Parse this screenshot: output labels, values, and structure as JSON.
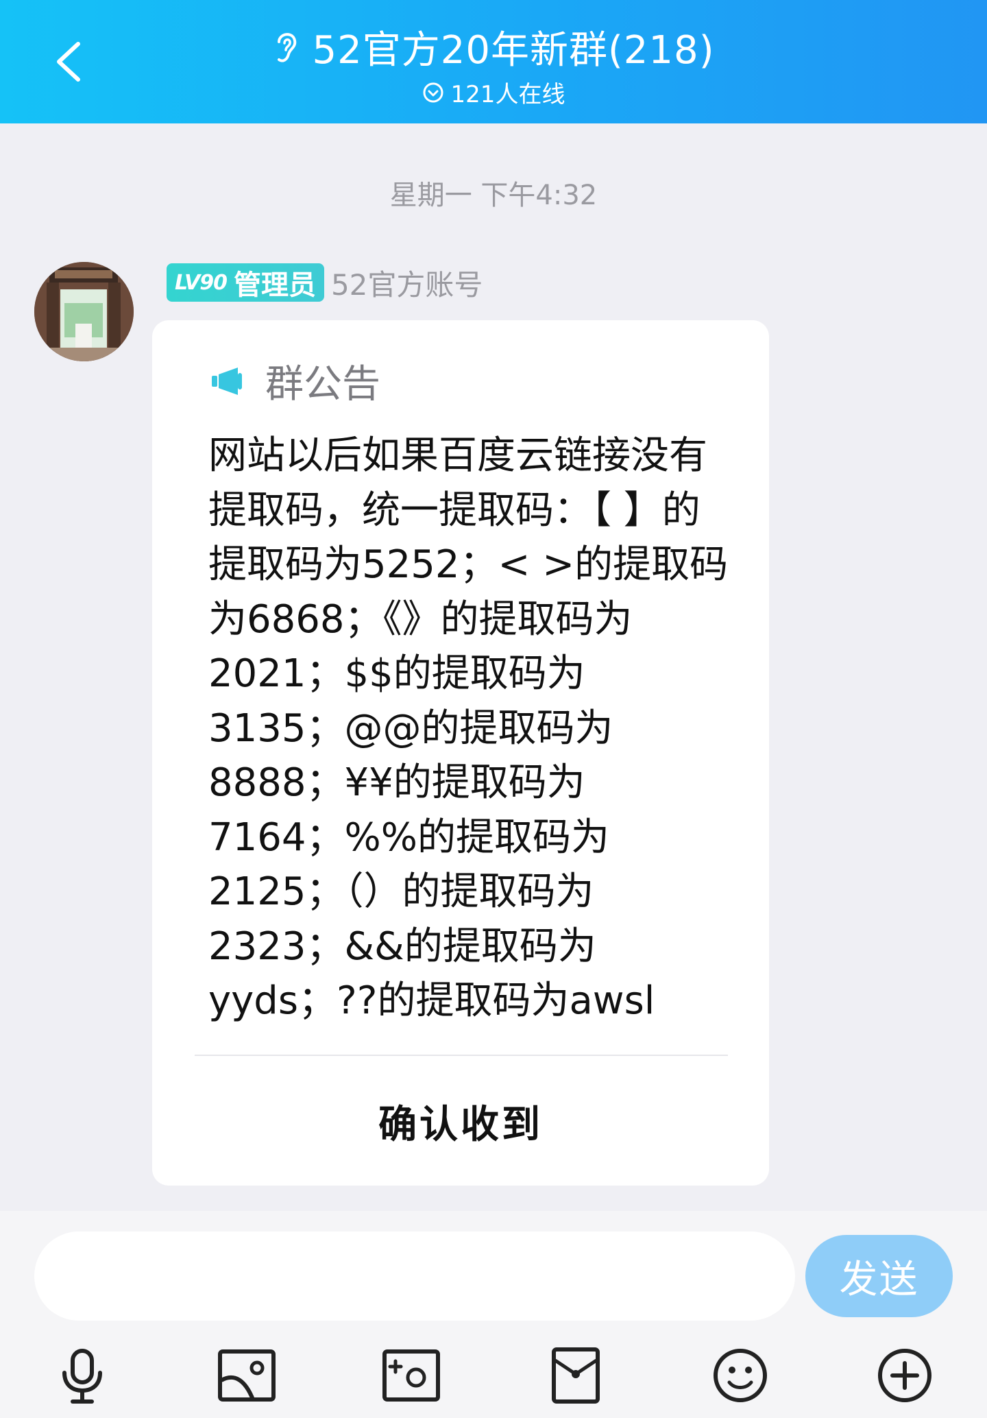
{
  "header": {
    "title": "52官方20年新群(218)",
    "online_text": "121人在线",
    "back_icon": "chevron-left-icon",
    "ear_icon": "ear-icon",
    "online_icon": "check-circle-icon",
    "accent_color": "#1aa8f6"
  },
  "chat": {
    "timestamp": "星期一 下午4:32",
    "message": {
      "level_badge": "LV90",
      "role": "管理员",
      "sender_name": "52官方账号",
      "announcement": {
        "icon": "megaphone-icon",
        "title": "群公告",
        "body": "网站以后如果百度云链接没有提取码，统一提取码：【 】的提取码为5252；< >的提取码为6868；《》的提取码为2021；$$的提取码为3135；@@的提取码为8888；¥¥的提取码为7164；%%的提取码为2125；（）的提取码为2323；&&的提取码为yyds；??的提取码为awsl",
        "body_lines": [
          "网站以后如果百度云链接没有",
          "提取码，统一提取码：【 】的",
          "提取码为5252；< >的提取码",
          "为6868；《》的提取码为",
          "2021；$$的提取码为",
          "3135；@@的提取码为",
          "8888；¥¥的提取码为",
          "7164；%%的提取码为",
          "2125；（）的提取码为",
          "2323；&&的提取码为",
          "yyds；??的提取码为awsl"
        ],
        "confirm_label": "确认收到"
      }
    }
  },
  "composer": {
    "input_value": "",
    "send_label": "发送",
    "send_color": "#8fcdf8",
    "tools": [
      "microphone-icon",
      "image-icon",
      "camera-icon",
      "red-packet-icon",
      "emoji-icon",
      "plus-icon"
    ]
  }
}
